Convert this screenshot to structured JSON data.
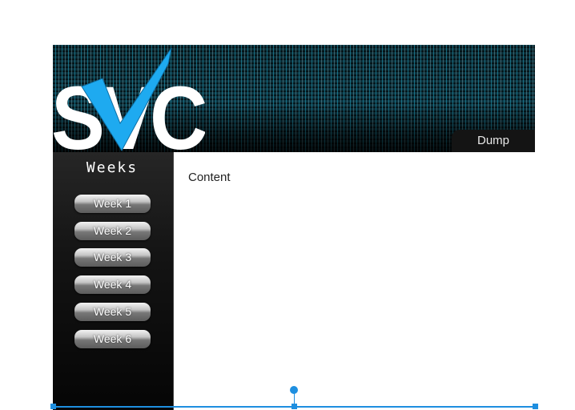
{
  "header": {
    "logo_text": "SVC",
    "tab_label": "Dump"
  },
  "sidebar": {
    "title": "Weeks",
    "items": [
      {
        "label": "Week 1"
      },
      {
        "label": "Week 2"
      },
      {
        "label": "Week 3"
      },
      {
        "label": "Week 4"
      },
      {
        "label": "Week 5"
      },
      {
        "label": "Week 6"
      }
    ]
  },
  "main": {
    "content_label": "Content"
  },
  "colors": {
    "accent": "#1eaaf0",
    "selection": "#1e8fe0",
    "sidebar_bg": "#141414",
    "header_bg": "#0c3643"
  }
}
